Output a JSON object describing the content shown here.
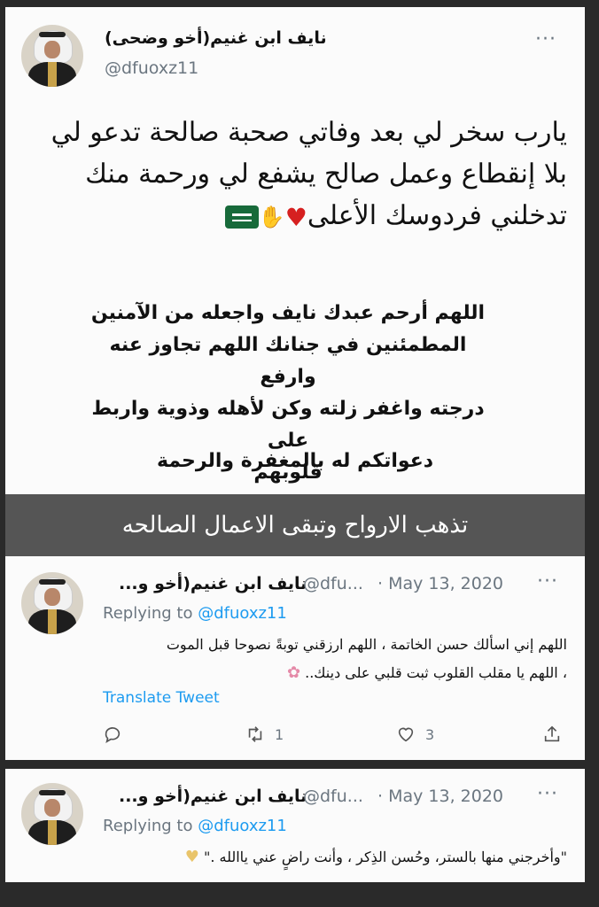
{
  "tweet1": {
    "name": "نايف ابن غنيم(أخو وضحى)",
    "handle": "@dfuoxz11",
    "more": "···",
    "main_lines": [
      "يارب سخر لي بعد وفاتي صحبة صالحة تدعو لي",
      "بلا إنقطاع وعمل صالح يشفع لي ورحمة منك",
      "تدخلني فردوسك الأعلى"
    ],
    "prayer_lines": [
      "اللهم أرحم عبدك نايف واجعله من الآمنين",
      "المطمئنين في جنانك اللهم تجاوز عنه وارفع",
      "درجته واغفر زلته وكن لأهله وذوية واربط على",
      "قلوبهم"
    ],
    "appeal": "دعواتكم له بالمغفرة والرحمة"
  },
  "caption": "تذهب الارواح وتبقى الاعمال الصالحه",
  "tweet2": {
    "name": "نايف ابن غنيم(أخو و...",
    "handle": "@dfu...",
    "date": "· May 13, 2020",
    "more": "···",
    "replying_prefix": "Replying to ",
    "replying_handle": "@dfuoxz11",
    "lines": [
      "اللهم إني اسألك حسن الخاتمة ، اللهم ارزقني توبةً نصوحا قبل الموت",
      "، اللهم يا مقلب القلوب ثبت قلبي على دينك.."
    ],
    "translate": "Translate Tweet",
    "retweets": "1",
    "likes": "3"
  },
  "tweet3": {
    "name": "نايف ابن غنيم(أخو و...",
    "handle": "@dfu...",
    "date": "· May 13, 2020",
    "more": "···",
    "replying_prefix": "Replying to ",
    "replying_handle": "@dfuoxz11",
    "lines": [
      "\"وأخرجني منها بالستر، وحُسن الذِكر ، وأنت راضٍ عني ياالله .\""
    ]
  },
  "icons": {
    "reply": "reply-icon",
    "retweet": "retweet-icon",
    "like": "heart-icon",
    "share": "share-icon"
  },
  "colors": {
    "link": "#1d9bf0",
    "muted": "#6b7680",
    "caption_bg": "#555555"
  }
}
